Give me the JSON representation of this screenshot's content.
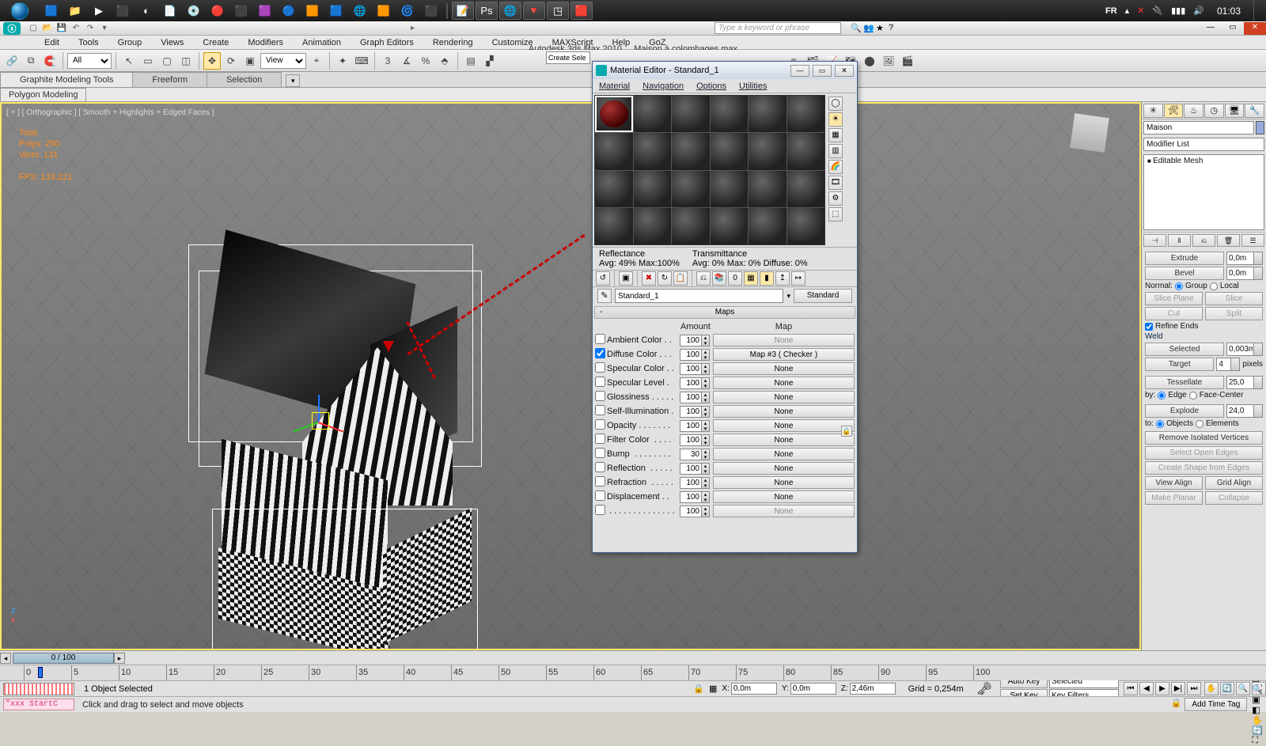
{
  "taskbar": {
    "lang": "FR",
    "clock": "01:03",
    "icons": [
      "🟦",
      "📁",
      "▶",
      "⬛",
      "◐",
      "📄",
      "💿",
      "🔴",
      "⬛",
      "🟪",
      "🔵",
      "🟧",
      "🟦",
      "🌐",
      "🟧",
      "🌀",
      "⬛"
    ],
    "activeApps": [
      "📝",
      "Ps",
      "🌐",
      "🔻",
      "◳",
      "🟥"
    ]
  },
  "app": {
    "product": "Autodesk 3ds Max  2010",
    "doc": "Maison à colombages.max",
    "searchPlaceholder": "Type a keyword or phrase",
    "menus": [
      "Edit",
      "Tools",
      "Group",
      "Views",
      "Create",
      "Modifiers",
      "Animation",
      "Graph Editors",
      "Rendering",
      "Customize",
      "MAXScript",
      "Help",
      "GoZ"
    ],
    "ribbonTabs": [
      "Graphite Modeling Tools",
      "Freeform",
      "Selection"
    ],
    "ribbonRow2": "Polygon Modeling",
    "filterLabel": "All",
    "viewLabel": "View",
    "createSel": "Create Sele"
  },
  "viewport": {
    "label": "[ + ] [ Orthographic ] [ Smooth + Highlights + Edged Faces ]",
    "stats": {
      "total": "Total",
      "polys": "Polys:   250",
      "verts": "Verts:   131",
      "fps": "FPS:    133,221"
    }
  },
  "materialEditor": {
    "title": "Material Editor - Standard_1",
    "menus": [
      "Material",
      "Navigation",
      "Options",
      "Utilities"
    ],
    "reflectance": {
      "hdr": "Reflectance",
      "val": "Avg:  49% Max:100%"
    },
    "transmittance": {
      "hdr": "Transmittance",
      "val": "Avg:   0% Max:   0%  Diffuse:   0%"
    },
    "matName": "Standard_1",
    "matType": "Standard",
    "rollup": "Maps",
    "cols": {
      "amount": "Amount",
      "map": "Map"
    },
    "rows": [
      {
        "on": false,
        "label": "Ambient Color . .",
        "amt": "100",
        "map": "None",
        "dis": true
      },
      {
        "on": true,
        "label": "Diffuse Color . . .",
        "amt": "100",
        "map": "Map #3  ( Checker )"
      },
      {
        "on": false,
        "label": "Specular Color . .",
        "amt": "100",
        "map": "None"
      },
      {
        "on": false,
        "label": "Specular Level .",
        "amt": "100",
        "map": "None"
      },
      {
        "on": false,
        "label": "Glossiness . . . . .",
        "amt": "100",
        "map": "None"
      },
      {
        "on": false,
        "label": "Self-Illumination .",
        "amt": "100",
        "map": "None"
      },
      {
        "on": false,
        "label": "Opacity . . . . . . .",
        "amt": "100",
        "map": "None"
      },
      {
        "on": false,
        "label": "Filter Color  . . . .",
        "amt": "100",
        "map": "None"
      },
      {
        "on": false,
        "label": "Bump  . . . . . . . .",
        "amt": "30",
        "map": "None"
      },
      {
        "on": false,
        "label": "Reflection  . . . . .",
        "amt": "100",
        "map": "None"
      },
      {
        "on": false,
        "label": "Refraction  . . . . .",
        "amt": "100",
        "map": "None"
      },
      {
        "on": false,
        "label": "Displacement . .",
        "amt": "100",
        "map": "None"
      },
      {
        "on": false,
        "label": " . . . . . . . . . . . . . .",
        "amt": "100",
        "map": "None",
        "dis": true
      }
    ]
  },
  "cmdPanel": {
    "objName": "Maison",
    "modList": "Modifier List",
    "stackItem": "Editable Mesh",
    "extrude": {
      "lbl": "Extrude",
      "val": "0,0m"
    },
    "bevel": {
      "lbl": "Bevel",
      "val": "0,0m"
    },
    "normal": {
      "lbl": "Normal:",
      "optA": "Group",
      "optB": "Local"
    },
    "slice": {
      "a": "Slice Plane",
      "b": "Slice",
      "c": "Cut",
      "d": "Split",
      "refine": "Refine Ends"
    },
    "weld": {
      "hdr": "Weld",
      "sel": "Selected",
      "selv": "0,003m",
      "tgt": "Target",
      "tgtv": "4",
      "unit": "pixels"
    },
    "tess": {
      "lbl": "Tessellate",
      "val": "25,0",
      "by": "by:",
      "optA": "Edge",
      "optB": "Face-Center"
    },
    "explode": {
      "lbl": "Explode",
      "val": "24,0",
      "to": "to:",
      "optA": "Objects",
      "optB": "Elements"
    },
    "btns": {
      "riv": "Remove Isolated Vertices",
      "soe": "Select Open Edges",
      "csf": "Create Shape from Edges",
      "va": "View Align",
      "ga": "Grid Align",
      "mp": "Make Planar",
      "col": "Collapse"
    }
  },
  "timeline": {
    "scrub": "0 / 100",
    "marks": [
      0,
      5,
      10,
      15,
      20,
      25,
      30,
      35,
      40,
      45,
      50,
      55,
      60,
      65,
      70,
      75,
      80,
      85,
      90,
      95,
      100
    ]
  },
  "status": {
    "selection": "1 Object Selected",
    "coords": {
      "x": "0,0m",
      "y": "0,0m",
      "z": "2,46m"
    },
    "grid": "Grid = 0,254m",
    "autoKey": "Auto Key",
    "setKey": "Set Key",
    "selected": "Selected",
    "keyFilters": "Key Filters...",
    "prompt": "Click and drag to select and move objects",
    "script": "\"xxx StartC",
    "addTag": "Add Time Tag"
  }
}
